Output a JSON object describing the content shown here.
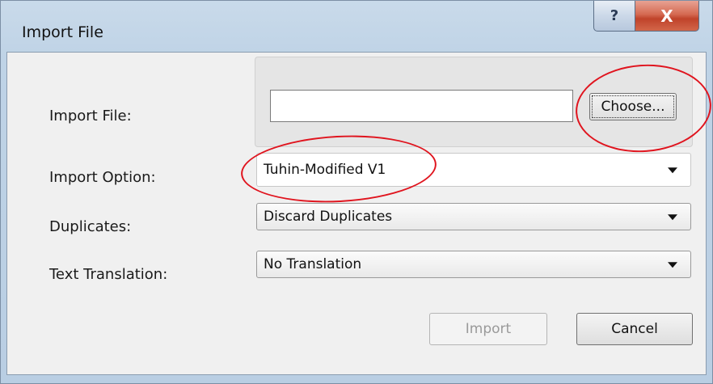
{
  "window": {
    "title": "Import File",
    "help_label": "?",
    "close_label": "X"
  },
  "form": {
    "import_file_label": "Import File:",
    "import_file_value": "",
    "choose_label": "Choose...",
    "import_option_label": "Import Option:",
    "import_option_value": "Tuhin-Modified V1",
    "duplicates_label": "Duplicates:",
    "duplicates_value": "Discard Duplicates",
    "text_translation_label": "Text Translation:",
    "text_translation_value": "No Translation"
  },
  "buttons": {
    "import_label": "Import",
    "cancel_label": "Cancel"
  },
  "colors": {
    "annotation": "#e0141e",
    "frame": "#bfd3e6",
    "close_button": "#c0432a"
  },
  "icons": {
    "help": "question-mark-icon",
    "close": "close-icon",
    "dropdown": "chevron-down-icon"
  }
}
